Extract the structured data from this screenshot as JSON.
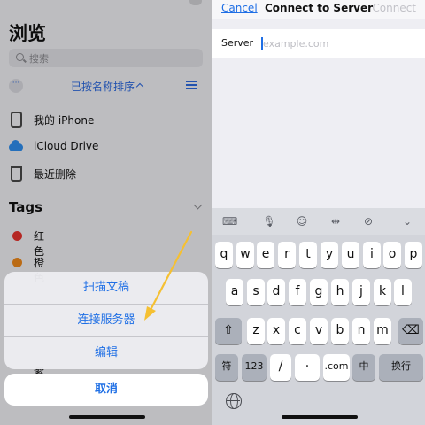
{
  "files": {
    "title": "浏览",
    "search_placeholder": "搜索",
    "sort_label": "已按名称排序",
    "locations": [
      {
        "label": "我的 iPhone",
        "icon": "iphone-icon"
      },
      {
        "label": "iCloud Drive",
        "icon": "icloud-icon"
      },
      {
        "label": "最近删除",
        "icon": "trash-icon"
      }
    ],
    "tags_title": "Tags",
    "tags": [
      {
        "label": "红色",
        "color": "#e8322d"
      },
      {
        "label": "橙色",
        "color": "#f08a1c"
      }
    ],
    "partial_tag_label": "紫色"
  },
  "action_sheet": {
    "items": [
      "扫描文稿",
      "连接服务器",
      "编辑"
    ],
    "cancel": "取消",
    "arrow_color": "#f5c032"
  },
  "connect": {
    "cancel": "Cancel",
    "title": "Connect to Server",
    "connect": "Connect",
    "server_label": "Server",
    "server_placeholder": "example.com",
    "server_value": ""
  },
  "keyboard": {
    "row1": [
      "q",
      "w",
      "e",
      "r",
      "t",
      "y",
      "u",
      "i",
      "o",
      "p"
    ],
    "row2": [
      "a",
      "s",
      "d",
      "f",
      "g",
      "h",
      "j",
      "k",
      "l"
    ],
    "row3": [
      "z",
      "x",
      "c",
      "v",
      "b",
      "n",
      "m"
    ],
    "bottom": {
      "symbols": "符",
      "numbers": "123",
      "slash": "/",
      "dot": "·",
      "dotcom": ".com",
      "lang": "中",
      "return": "换行"
    },
    "toolbar_icons": [
      "keyboard-switch-icon",
      "microphone-icon",
      "emoji-icon",
      "cursor-move-icon",
      "handwriting-icon",
      "dismiss-keyboard-icon"
    ]
  }
}
